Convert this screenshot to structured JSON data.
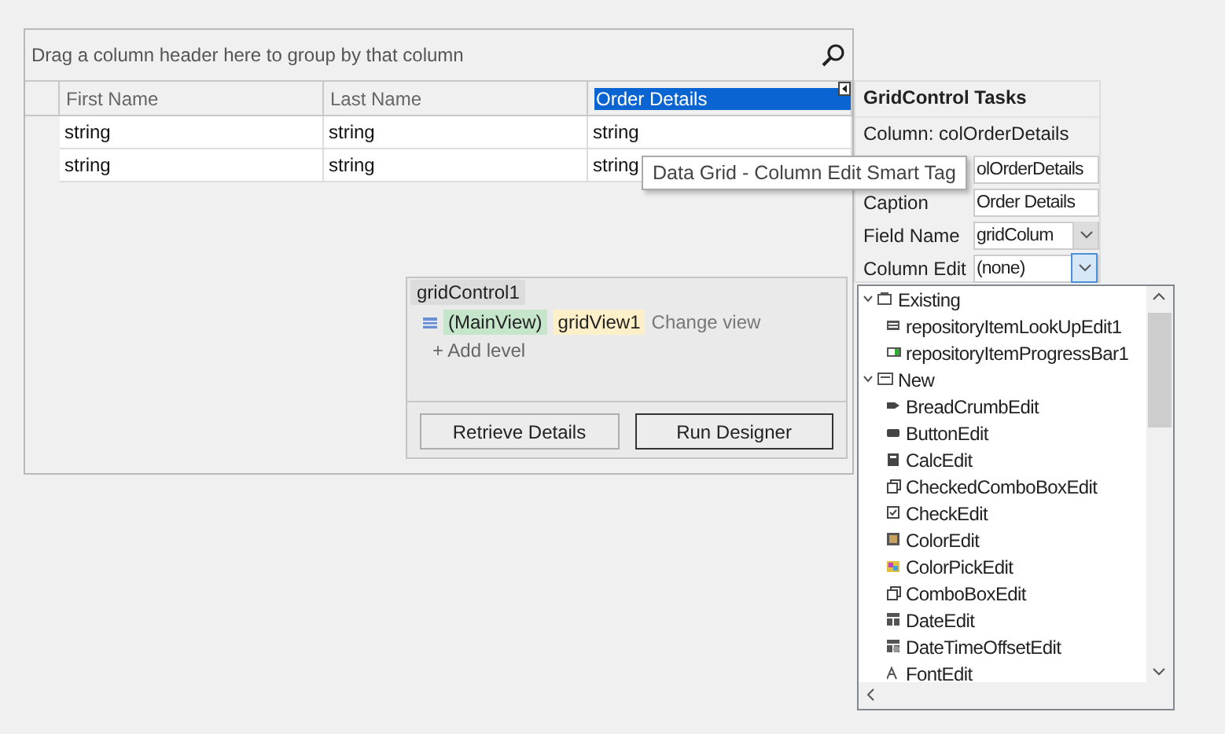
{
  "grid": {
    "group_panel": "Drag a column header here to group by that column",
    "columns": [
      {
        "label": "First Name",
        "selected": false
      },
      {
        "label": "Last Name",
        "selected": false
      },
      {
        "label": "Order Details",
        "selected": true
      }
    ],
    "rows": [
      [
        "string",
        "string",
        "string"
      ],
      [
        "string",
        "string",
        "string"
      ]
    ]
  },
  "level_designer": {
    "root": "gridControl1",
    "main_view": "(MainView)",
    "view_name": "gridView1",
    "change_view": "Change view",
    "add_level": "+ Add level",
    "buttons": [
      {
        "label": "Retrieve Details",
        "default": false
      },
      {
        "label": "Run Designer",
        "default": true
      }
    ]
  },
  "tasks": {
    "title": "GridControl Tasks",
    "column": "Column: colOrderDetails",
    "fields": [
      {
        "kind": "text",
        "value": "olOrderDetails"
      },
      {
        "kind": "text",
        "label": "Caption",
        "value": "Order Details"
      },
      {
        "kind": "combo",
        "label": "Field Name",
        "value": "gridColum",
        "open": false
      },
      {
        "kind": "combo",
        "label": "Column Edit",
        "value": "(none)",
        "open": true
      }
    ]
  },
  "editor_list": {
    "groups": [
      {
        "label": "Existing",
        "expanded": true,
        "children": [
          {
            "label": "repositoryItemLookUpEdit1"
          },
          {
            "label": "repositoryItemProgressBar1"
          }
        ]
      },
      {
        "label": "New",
        "expanded": true,
        "children": [
          {
            "label": "BreadCrumbEdit"
          },
          {
            "label": "ButtonEdit"
          },
          {
            "label": "CalcEdit"
          },
          {
            "label": "CheckedComboBoxEdit"
          },
          {
            "label": "CheckEdit"
          },
          {
            "label": "ColorEdit"
          },
          {
            "label": "ColorPickEdit"
          },
          {
            "label": "ComboBoxEdit"
          },
          {
            "label": "DateEdit"
          },
          {
            "label": "DateTimeOffsetEdit"
          },
          {
            "label": "FontEdit"
          }
        ]
      }
    ]
  },
  "tooltip": "Data Grid - Column Edit Smart Tag"
}
